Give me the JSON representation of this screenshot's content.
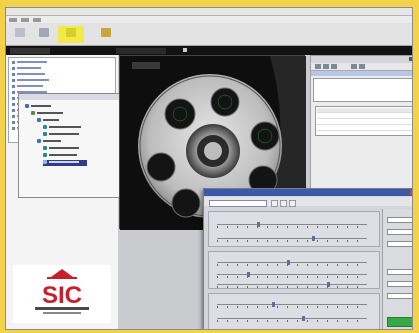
{
  "logo": {
    "text": "SIC",
    "colors": {
      "red": "#c8202a",
      "dark": "#4a4a4a"
    }
  },
  "icons": {
    "toolbar": [
      "open-icon",
      "acquire-icon",
      "settings-icon",
      "inspect-icon"
    ],
    "viewer": "rotor-wafer-image"
  },
  "colors": {
    "frame": "#f1d24a",
    "selection": "#2f3b86",
    "dialog_title": "#3a5aa8",
    "start_button": "#38a845"
  }
}
